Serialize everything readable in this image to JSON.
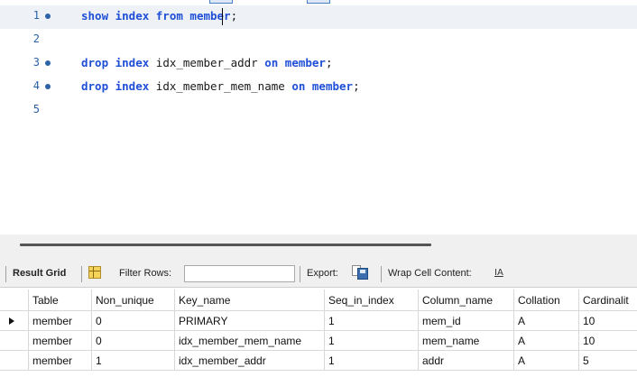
{
  "editor": {
    "lines": [
      {
        "number": "1",
        "kw1": "show index from",
        "rest": " mem",
        "rest2": "ber",
        "end": ";"
      },
      {
        "number": "2"
      },
      {
        "number": "3",
        "kw1": "drop index",
        "ident": " idx_member_addr ",
        "kw2": "on",
        "tbl": " member",
        "end": ";"
      },
      {
        "number": "4",
        "kw1": "drop index",
        "ident": " idx_member_mem_name ",
        "kw2": "on",
        "tbl": " member",
        "end": ";"
      },
      {
        "number": "5"
      }
    ]
  },
  "result_toolbar": {
    "result_grid_label": "Result Grid",
    "filter_rows_label": "Filter Rows:",
    "filter_rows_value": "",
    "export_label": "Export:",
    "wrap_label": "Wrap Cell Content:",
    "wrap_icon": "wrap-text-icon"
  },
  "table": {
    "columns": [
      "Table",
      "Non_unique",
      "Key_name",
      "Seq_in_index",
      "Column_name",
      "Collation",
      "Cardinalit"
    ],
    "rows": [
      [
        "member",
        "0",
        "PRIMARY",
        "1",
        "mem_id",
        "A",
        "10"
      ],
      [
        "member",
        "0",
        "idx_member_mem_name",
        "1",
        "mem_name",
        "A",
        "10"
      ],
      [
        "member",
        "1",
        "idx_member_addr",
        "1",
        "addr",
        "A",
        "5"
      ]
    ]
  },
  "colors": {
    "keyword": "#1f4fd6",
    "line_number": "#2b62a8",
    "current_line": "#eef1f6"
  }
}
